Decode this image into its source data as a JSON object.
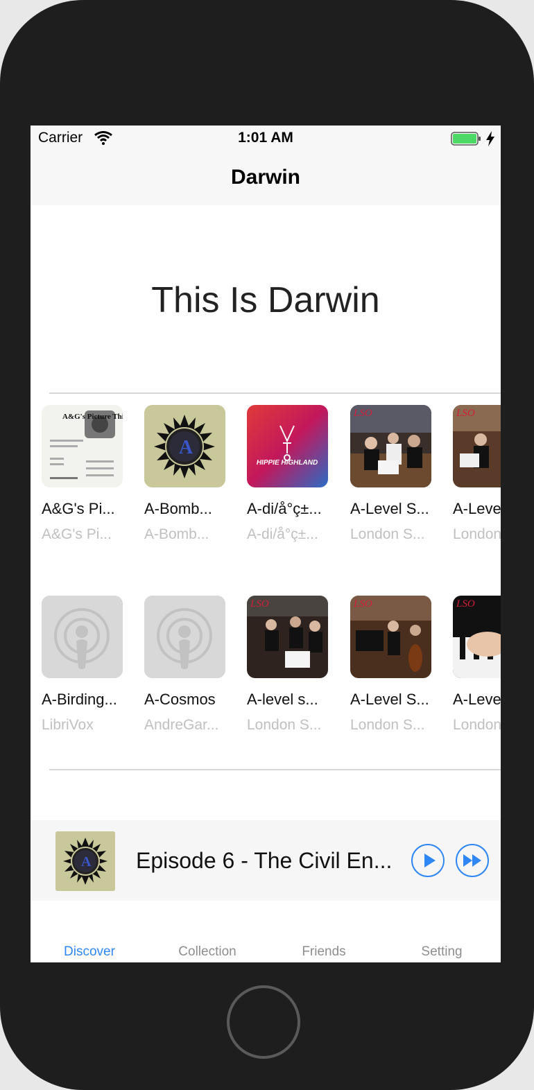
{
  "status_bar": {
    "carrier": "Carrier",
    "time": "1:01 AM"
  },
  "nav": {
    "title": "Darwin"
  },
  "hero": {
    "title": "This Is Darwin"
  },
  "grid": {
    "row1": [
      {
        "title": "A&G's Pi...",
        "subtitle": "A&G's Pi...",
        "art": "picture-this"
      },
      {
        "title": "A-Bomb...",
        "subtitle": "A-Bomb...",
        "art": "a-bomb"
      },
      {
        "title": "A-di/å°ç±...",
        "subtitle": "A-di/å°ç±...",
        "art": "hippie-highland"
      },
      {
        "title": "A-Level S...",
        "subtitle": "London S...",
        "art": "lso-orchestra"
      },
      {
        "title": "A-Leve",
        "subtitle": "London",
        "art": "lso-orchestra"
      }
    ],
    "row2": [
      {
        "title": "A-Birding...",
        "subtitle": "LibriVox",
        "art": "podcast-placeholder"
      },
      {
        "title": "A-Cosmos",
        "subtitle": "AndreGar...",
        "art": "podcast-placeholder"
      },
      {
        "title": "A-level s...",
        "subtitle": "London S...",
        "art": "lso-orchestra"
      },
      {
        "title": "A-Level S...",
        "subtitle": "London S...",
        "art": "lso-orchestra"
      },
      {
        "title": "A-Leve",
        "subtitle": "London",
        "art": "lso-piano"
      }
    ],
    "art_labels": {
      "picture_this": "A&G's Picture This!",
      "hippie_highland": "HIPPIE HIGHLAND",
      "lso": "LSO"
    }
  },
  "mini_player": {
    "title": "Episode 6 - The Civil En...",
    "play_icon": "play-icon",
    "forward_icon": "fast-forward-icon"
  },
  "tabs": [
    {
      "label": "Discover",
      "active": true
    },
    {
      "label": "Collection",
      "active": false
    },
    {
      "label": "Friends",
      "active": false
    },
    {
      "label": "Setting",
      "active": false
    }
  ],
  "colors": {
    "accent": "#2f87f5",
    "battery": "#4cd964",
    "placeholder_bg": "#d8d8d8",
    "a_bomb_bg": "#c9c89a"
  }
}
